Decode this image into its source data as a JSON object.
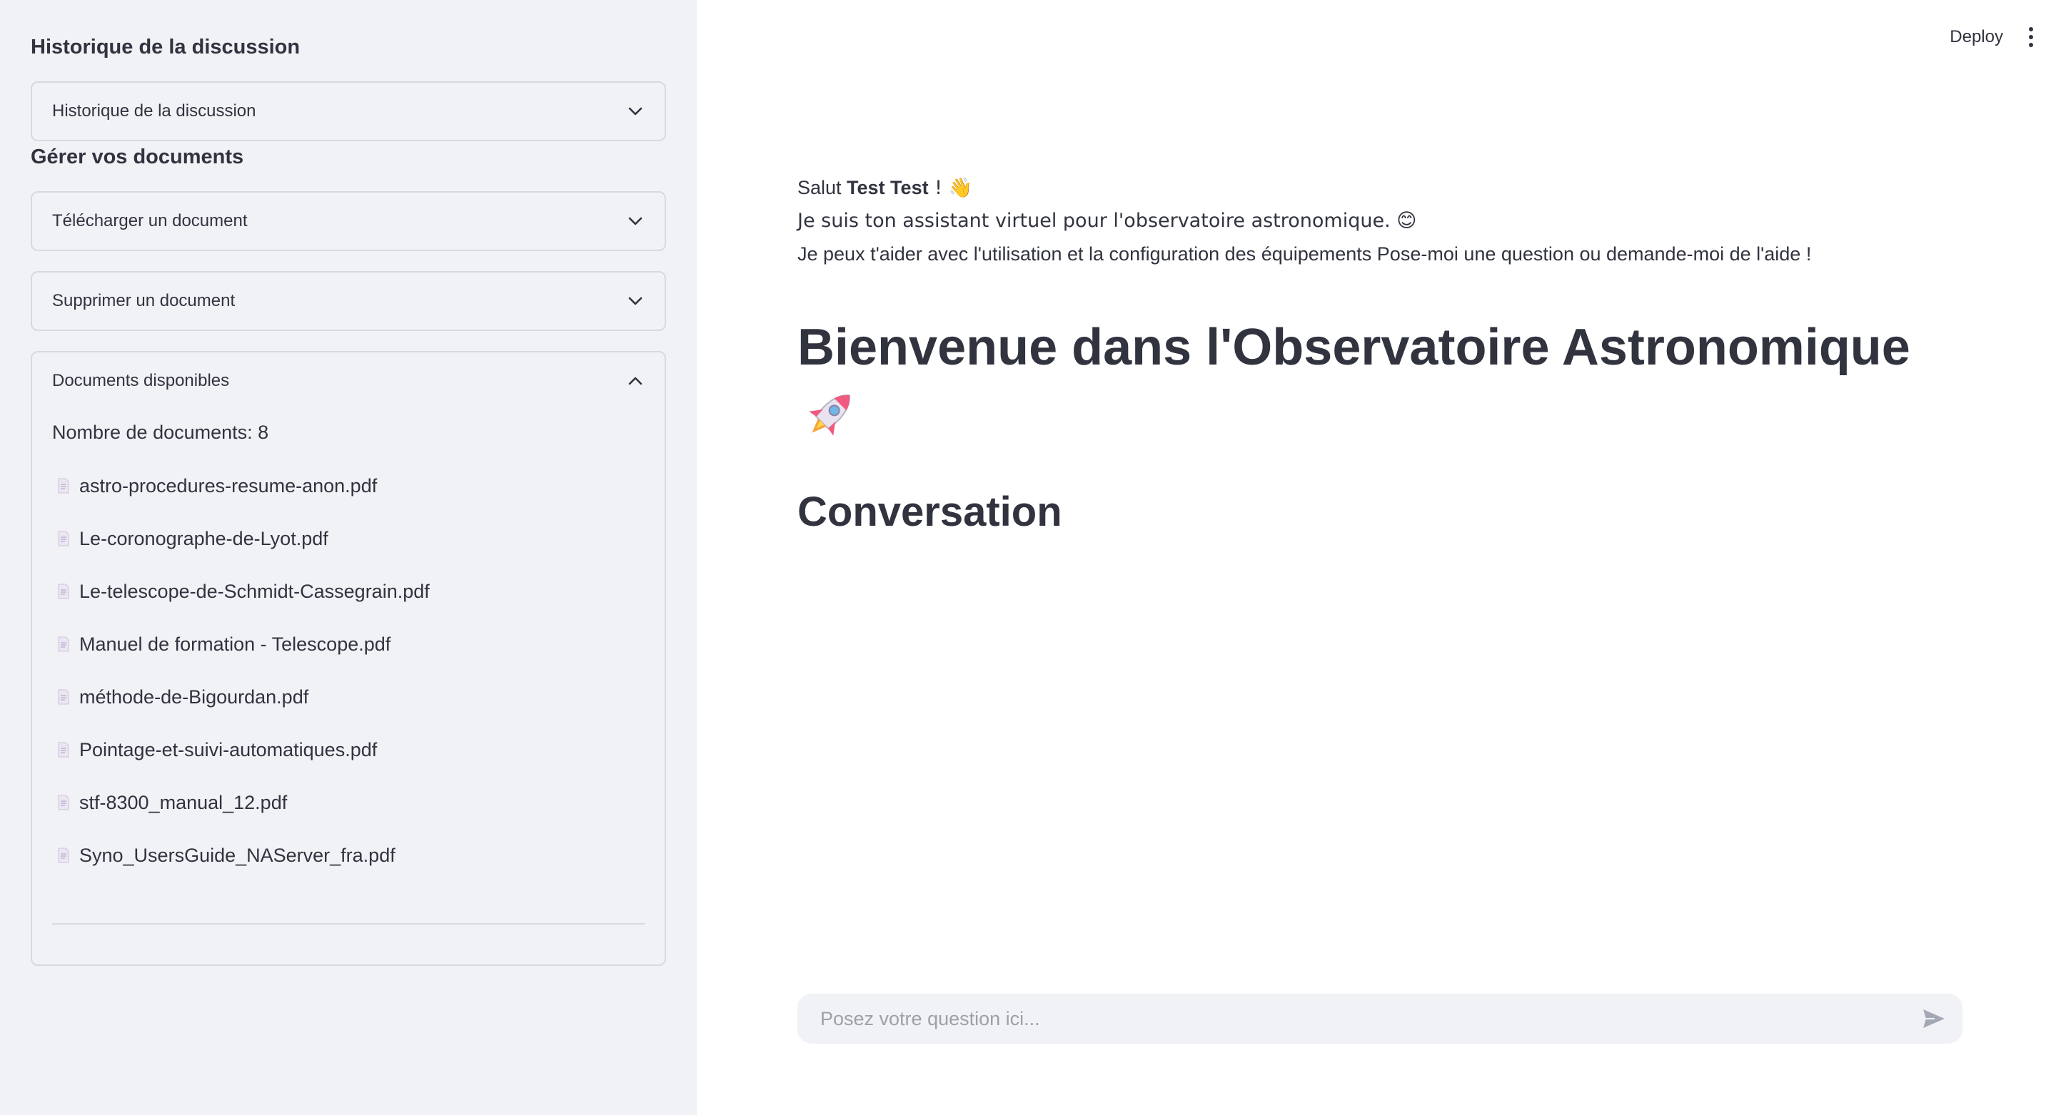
{
  "sidebar": {
    "history_title": "Historique de la discussion",
    "history_expander": "Historique de la discussion",
    "docs_title": "Gérer vos documents",
    "upload_expander": "Télécharger un document",
    "delete_expander": "Supprimer un document",
    "available_expander": "Documents disponibles",
    "doc_count": "Nombre de documents: 8",
    "documents": [
      "astro-procedures-resume-anon.pdf",
      "Le-coronographe-de-Lyot.pdf",
      "Le-telescope-de-Schmidt-Cassegrain.pdf",
      "Manuel de formation - Telescope.pdf",
      "méthode-de-Bigourdan.pdf",
      "Pointage-et-suivi-automatiques.pdf",
      "stf-8300_manual_12.pdf",
      "Syno_UsersGuide_NAServer_fra.pdf"
    ]
  },
  "header": {
    "deploy_label": "Deploy"
  },
  "main": {
    "greeting_prefix": "Salut ",
    "user_name": "Test Test",
    "greeting_suffix": " ! 👋",
    "intro_line2": "Je suis ton assistant virtuel pour l'observatoire astronomique. 😊",
    "intro_line3": "Je peux t'aider avec l'utilisation et la configuration des équipements Pose-moi une question ou demande-moi de l'aide !",
    "title": "Bienvenue dans l'Observatoire Astronomique",
    "conversation_title": "Conversation"
  },
  "chat": {
    "placeholder": "Posez votre question ici..."
  },
  "colors": {
    "sidebar_bg": "#f0f2f6",
    "text": "#31333f",
    "border": "#d6d9df",
    "placeholder": "#9ea0a8"
  }
}
